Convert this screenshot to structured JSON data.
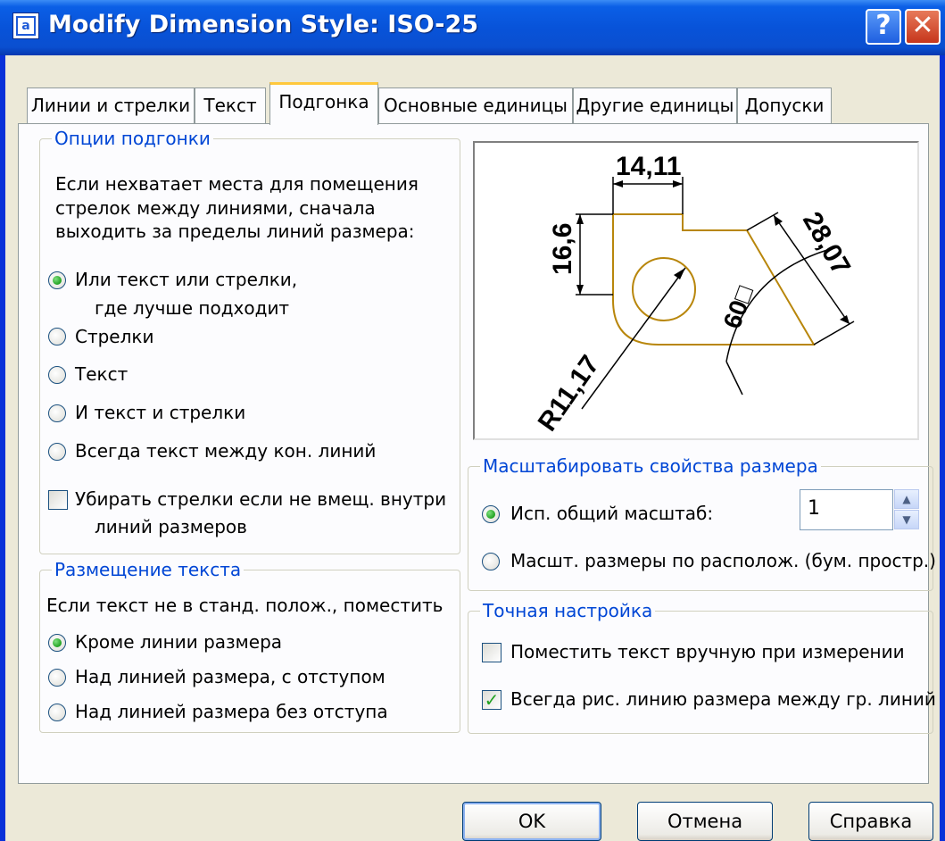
{
  "window": {
    "title": "Modify Dimension Style: ISO-25"
  },
  "tabs": [
    {
      "label": "Линии и стрелки"
    },
    {
      "label": "Текст"
    },
    {
      "label": "Подгонка"
    },
    {
      "label": "Основные единицы"
    },
    {
      "label": "Другие единицы"
    },
    {
      "label": "Допуски"
    }
  ],
  "fit_options": {
    "legend": "Опции подгонки",
    "description": [
      "Если нехватает места для помещения",
      "стрелок между линиями, сначала",
      "выходить за пределы линий размера:"
    ],
    "radio_1_line1": "Или текст или стрелки,",
    "radio_1_line2": "где лучше подходит",
    "radio_2": "Стрелки",
    "radio_3": "Текст",
    "radio_4": "И текст и стрелки",
    "radio_5": "Всегда текст между кон. линий",
    "suppress_line1": "Убирать стрелки если не вмещ. внутри",
    "suppress_line2": "линий размеров"
  },
  "text_placement": {
    "legend": "Размещение текста",
    "description": "Если текст не в станд. полож., поместить",
    "radio_1": "Кроме линии размера",
    "radio_2": "Над линией размера, с отступом",
    "radio_3": "Над линией размера без отступа"
  },
  "preview": {
    "dim_top": "14,11",
    "dim_left": "16,6",
    "dim_right": "28,07",
    "dim_angle": "60□",
    "dim_radius": "R11,17"
  },
  "scale": {
    "legend": "Масштабировать свойства размера",
    "overall_label": "Исп. общий масштаб:",
    "overall_value": "1",
    "layout_label": "Масшт. размеры по располож. (бум. простр.)"
  },
  "fine_tuning": {
    "legend": "Точная настройка",
    "manual_label": "Поместить текст вручную при измерении",
    "always_draw_label": "Всегда рис. линию размера между гр. линий"
  },
  "buttons": {
    "ok": "OK",
    "cancel": "Отмена",
    "help": "Справка"
  },
  "icons": {
    "app": "autocad-app-icon",
    "help": "question-mark-icon",
    "close": "close-x-icon"
  }
}
